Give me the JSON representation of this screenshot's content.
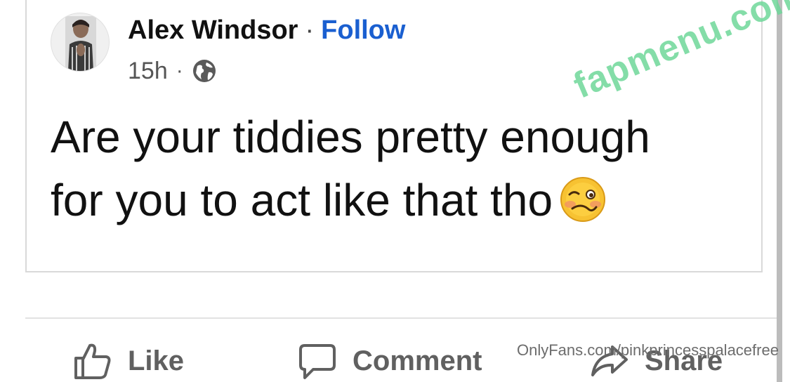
{
  "post": {
    "author": "Alex Windsor",
    "separator": "·",
    "follow_label": "Follow",
    "time": "15h",
    "meta_separator": "·",
    "audience_icon": "globe-icon",
    "text_line_1": "Are your tiddies pretty enough",
    "text_line_2": "for you to act like that tho",
    "emoji_icon": "woozy-face-emoji"
  },
  "actions": {
    "like_label": "Like",
    "comment_label": "Comment",
    "share_label": "Share"
  },
  "overlay": {
    "watermark": "fapmenu.com",
    "onlyfans_text": "OnlyFans.com/pinkprincesspalacefree"
  },
  "colors": {
    "follow": "#1a5fd0",
    "watermark": "#6fd89a",
    "action_text": "#606060"
  }
}
